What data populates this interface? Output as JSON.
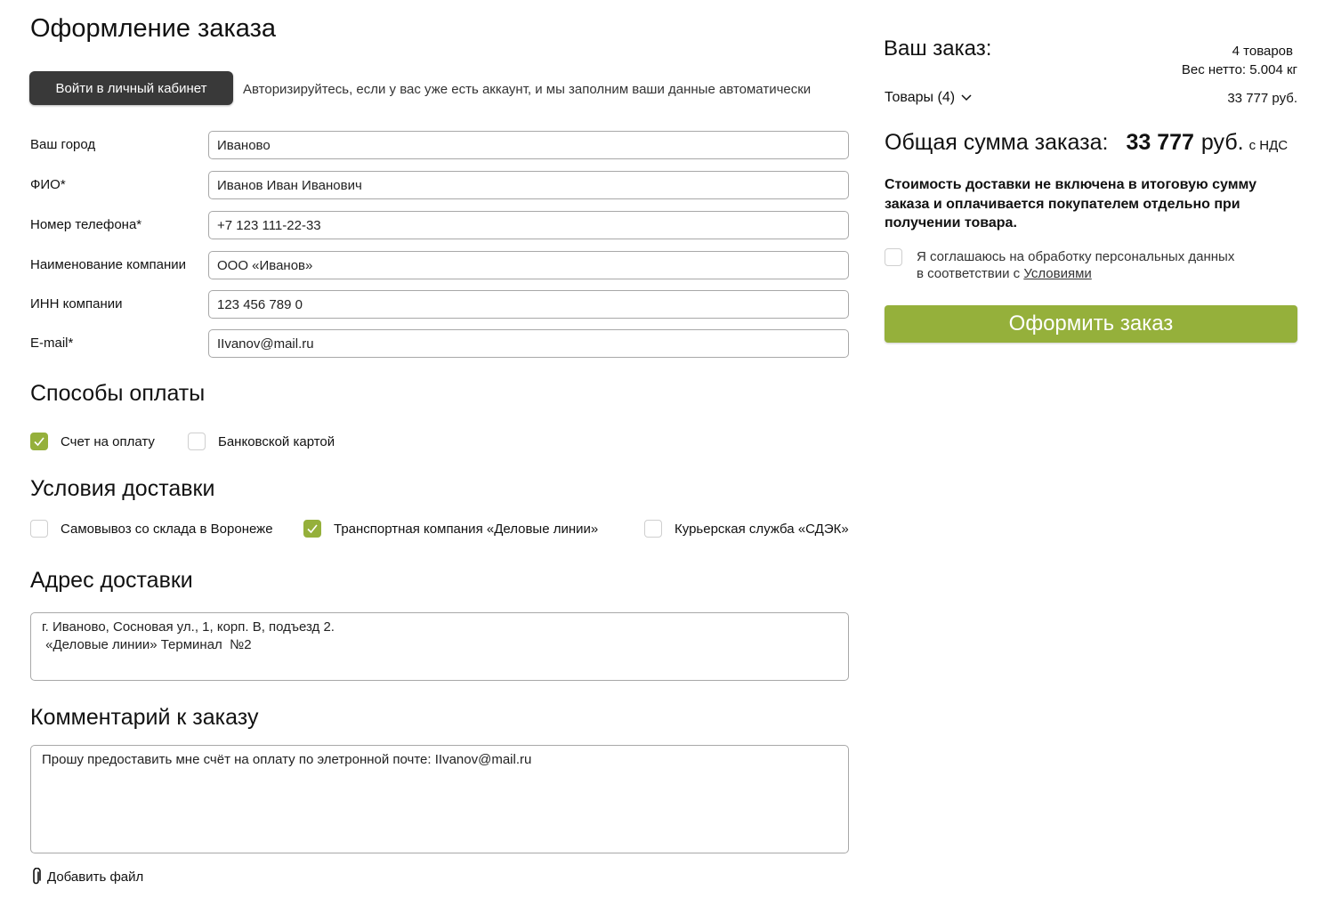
{
  "page_title": "Оформление заказа",
  "login": {
    "button_label": "Войти в личный кабинет",
    "hint": "Авторизируйтесь, если у вас уже есть аккаунт, и мы заполним ваши данные автоматически"
  },
  "form": {
    "city": {
      "label": "Ваш город",
      "value": "Иваново"
    },
    "name": {
      "label": "ФИО*",
      "value": "Иванов Иван Иванович"
    },
    "phone": {
      "label": "Номер телефона*",
      "value": "+7 123 111-22-33"
    },
    "company": {
      "label": "Наименование компании",
      "value": "ООО «Иванов»"
    },
    "inn": {
      "label": "ИНН компании",
      "value": "123 456 789 0"
    },
    "email": {
      "label": "E-mail*",
      "value": "IIvanov@mail.ru"
    }
  },
  "payment": {
    "title": "Способы оплаты",
    "options": [
      {
        "label": "Счет на оплату",
        "checked": true
      },
      {
        "label": "Банковской картой",
        "checked": false
      }
    ]
  },
  "delivery": {
    "title": "Условия доставки",
    "options": [
      {
        "label": "Самовывоз со склада в Воронеже",
        "checked": false
      },
      {
        "label": "Транспортная компания «Деловые линии»",
        "checked": true
      },
      {
        "label": "Курьерская служба «СДЭК»",
        "checked": false
      }
    ]
  },
  "address": {
    "title": "Адрес доставки",
    "value": "г. Иваново, Сосновая ул., 1, корп. В, подъезд 2.\n «Деловые линии» Терминал  №2"
  },
  "comment": {
    "title": "Комментарий к заказу",
    "value": "Прошу предоставить мне счёт на оплату по элетронной почте: IIvanov@mail.ru",
    "attach_label": "Добавить файл"
  },
  "order": {
    "title": "Ваш заказ:",
    "items_count": "4 товаров",
    "weight": "Вес нетто: 5.004 кг",
    "goods_label": "Товары (4)",
    "goods_sum": "33 777 руб.",
    "total_label": "Общая сумма заказа:",
    "total_value": "33 777",
    "total_currency": "руб.",
    "total_vat": "с НДС",
    "delivery_note": "Стоимость доставки не включена в итоговую сумму заказа и оплачивается покупателем отдельно при получении товара.",
    "agree_text_1": "Я соглашаюсь на обработку персональных данных",
    "agree_text_2": "в соответствии с ",
    "agree_link": "Условиями",
    "agree_checked": false,
    "submit_label": "Оформить заказ"
  },
  "colors": {
    "accent": "#95b03b",
    "dark_button": "#393939",
    "input_border": "#a8a8a8"
  }
}
